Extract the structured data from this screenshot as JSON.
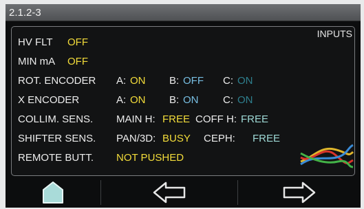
{
  "window": {
    "title": "2.1.2-3"
  },
  "panel": {
    "label": "INPUTS"
  },
  "rows": [
    {
      "label": "HV FLT",
      "value": "OFF"
    },
    {
      "label": "MIN mA",
      "value": "OFF"
    },
    {
      "label": "ROT. ENCODER",
      "a_label": "A:",
      "a_value": "ON",
      "b_label": "B:",
      "b_value": "OFF",
      "c_label": "C:",
      "c_value": "ON"
    },
    {
      "label": "X ENCODER",
      "a_label": "A:",
      "a_value": "ON",
      "b_label": "B:",
      "b_value": "ON",
      "c_label": "C:",
      "c_value": "ON"
    },
    {
      "label": "COLLIM. SENS.",
      "k1_label": "MAIN H:",
      "k1_value": "FREE",
      "k2_label": "COFF H:",
      "k2_value": "FREE"
    },
    {
      "label": "SHIFTER SENS.",
      "k1_label": "PAN/3D:",
      "k1_value": "BUSY",
      "k2_label": "CEPH:",
      "k2_value": "FREE"
    },
    {
      "label": "REMOTE BUTT.",
      "value": "NOT PUSHED"
    }
  ],
  "icons": {
    "home": "home-icon",
    "back": "arrow-left-icon",
    "forward": "arrow-right-icon",
    "wires": "wires-icon"
  },
  "colors": {
    "value_yellow": "#f3dc3a",
    "value_blue": "#78bfe3",
    "value_teal": "#9ed9d5",
    "value_dim": "#2e7f8e"
  }
}
